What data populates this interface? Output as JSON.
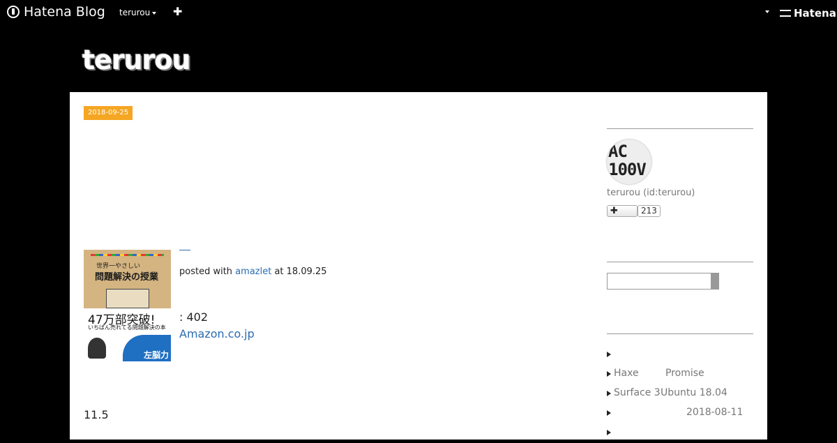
{
  "topbar": {
    "logo_text": "Hatena Blog",
    "user": "terurou",
    "add_icon": "plus-icon",
    "brand_right": "Hatena"
  },
  "blog": {
    "title": "terurou"
  },
  "entry": {
    "date": "2018-09-25",
    "book": {
      "cover_series": "世界一やさしい",
      "cover_title": "問題解決の授業",
      "cover_big": "47万部突破!",
      "cover_sub": "いちばん売れてる問題解決の本",
      "cover_badge": "左脳力",
      "link_text": "—",
      "posted_prefix": "posted with",
      "posted_link": "amazlet",
      "posted_suffix": "at 18.09.25",
      "pages": ": 402",
      "amazon_link": "Amazon.co.jp"
    },
    "body_text": "11.5"
  },
  "sidebar": {
    "profile": {
      "avatar_text": "AC\n100V",
      "name": "terurou (id:terurou)",
      "subscribe_icon": "plus-icon",
      "subscribers": "213"
    },
    "recent": [
      {
        "label": "",
        "date": ""
      },
      {
        "label": "Haxe",
        "date": "Promise"
      },
      {
        "label": "Surface 3",
        "date": "Ubuntu 18.04"
      },
      {
        "label": "",
        "date": "2018-08-11"
      },
      {
        "label": "",
        "date": ""
      }
    ]
  },
  "colors": {
    "date_badge": "#f5a623",
    "link": "#2b6cb0",
    "background": "#000000"
  }
}
